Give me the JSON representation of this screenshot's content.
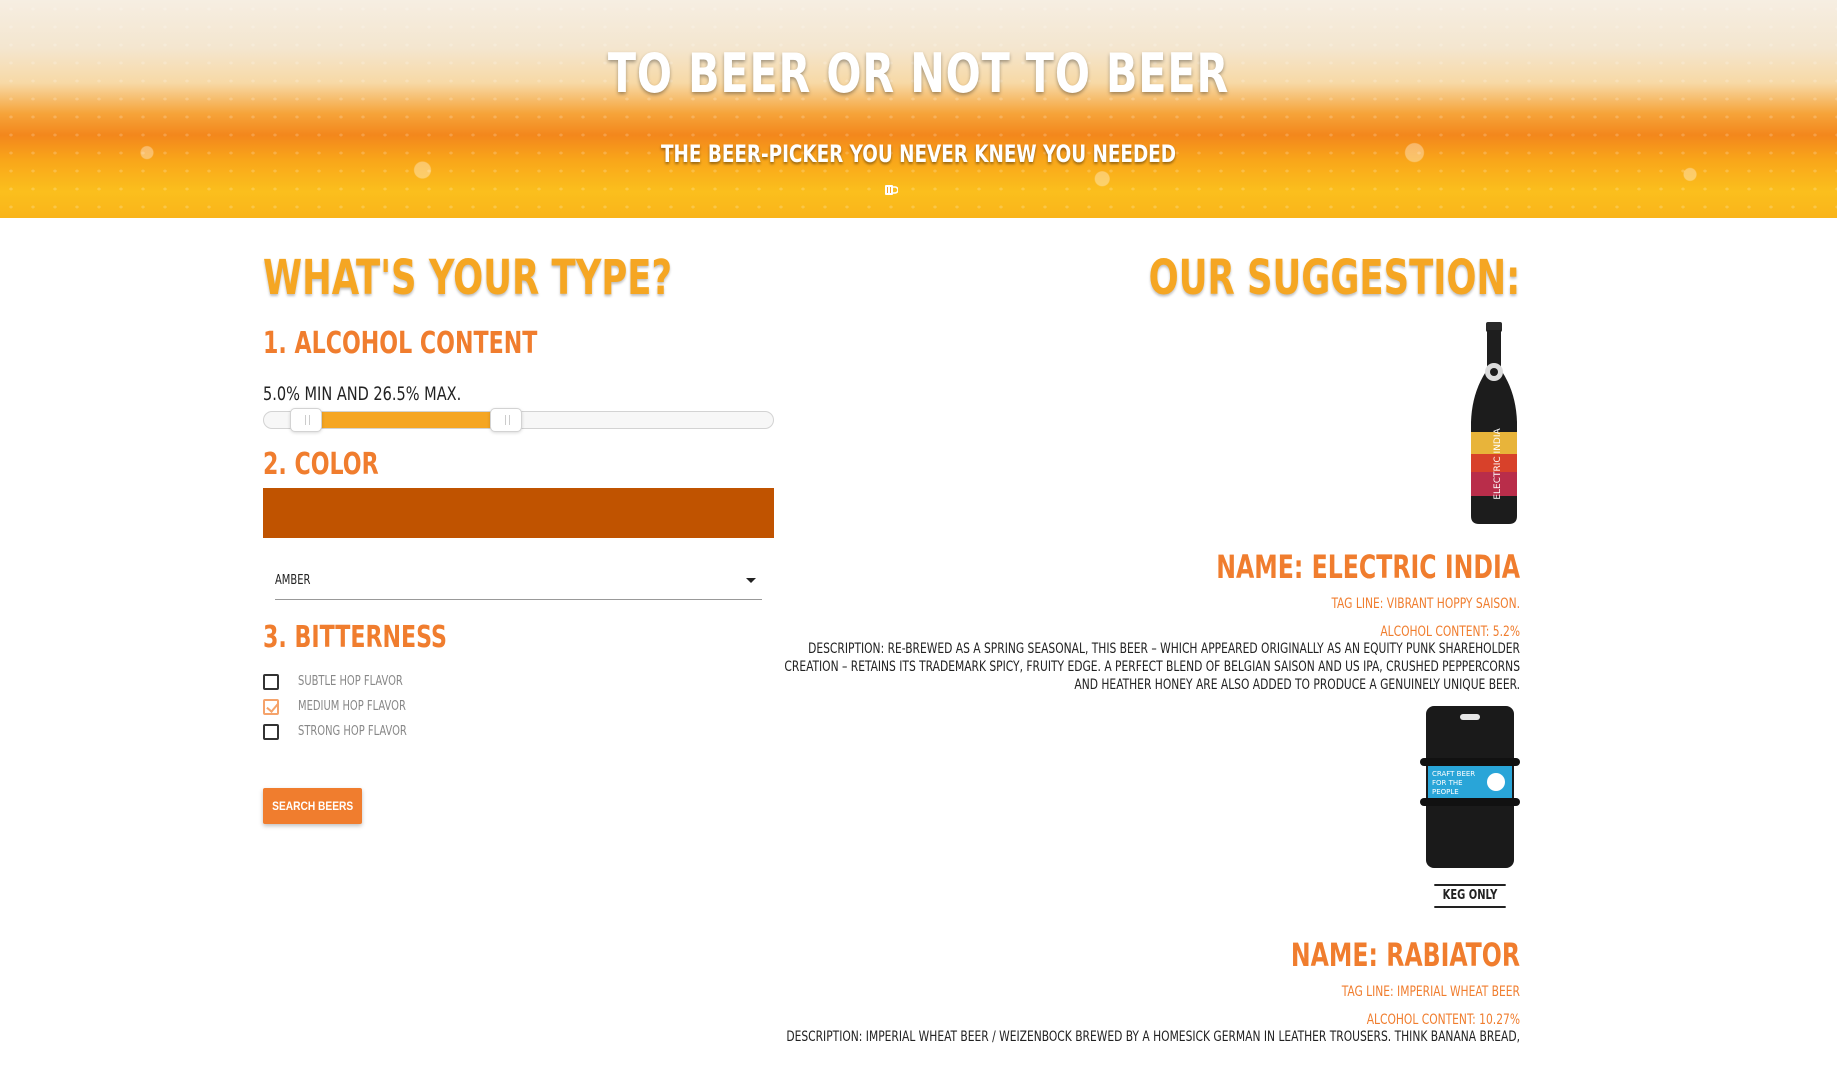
{
  "hero": {
    "title": "To Beer or Not to Beer",
    "subtitle": "The beer-picker you never knew you needed"
  },
  "form": {
    "heading": "What's your type?",
    "alcohol": {
      "title": "1. Alcohol Content",
      "readout": "5.0% min and 26.5% max.",
      "min_value": 5.0,
      "max_value": 26.5
    },
    "color": {
      "title": "2. Color",
      "swatch": "#c05300",
      "selected": "Amber"
    },
    "bitterness": {
      "title": "3. Bitterness",
      "options": [
        {
          "label": "Subtle hop flavor",
          "checked": false
        },
        {
          "label": "Medium hop flavor",
          "checked": true
        },
        {
          "label": "Strong hop flavor",
          "checked": false
        }
      ]
    },
    "search_label": "Search Beers"
  },
  "suggestion": {
    "heading": "Our Suggestion:",
    "beers": [
      {
        "name": "Name: Electric India",
        "tagline": "Tag Line: Vibrant Hoppy Saison.",
        "abv": "Alcohol Content: 5.2%",
        "description": "Description: Re-Brewed as a spring seasonal, this beer – which appeared originally as an Equity Punk shareholder creation – retains its trademark spicy, fruity edge. A perfect blend of Belgian Saison and US IPA, crushed peppercorns and heather honey are also added to produce a genuinely unique beer."
      },
      {
        "image_caption": "Keg Only",
        "keg_label": "CRAFT BEER FOR THE PEOPLE",
        "name": "Name: Rabiator",
        "tagline": "Tag Line: Imperial Wheat Beer",
        "abv": "Alcohol Content: 10.27%",
        "description": "Description: Imperial Wheat beer / Weizenbock brewed by a homesick German in leather trousers. Think banana bread,"
      }
    ]
  },
  "colors": {
    "accent_orange": "#f07d2e",
    "heading_yellow": "#f5a623"
  }
}
